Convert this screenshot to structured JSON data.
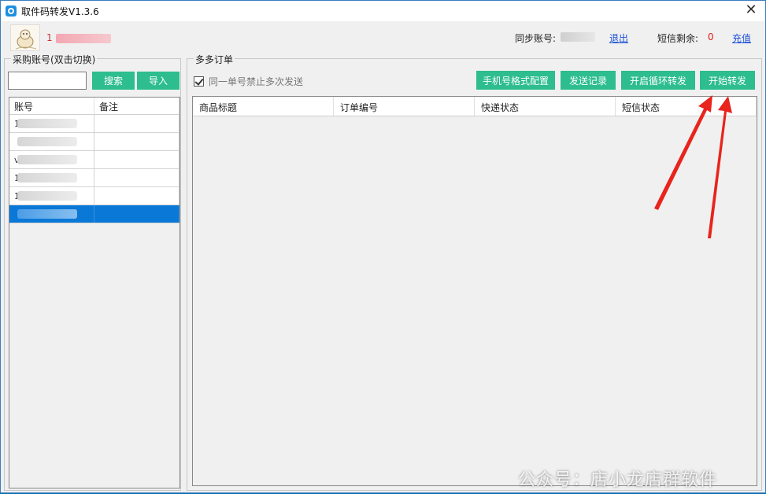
{
  "window": {
    "title": "取件码转发V1.3.6",
    "close_glyph": "✕"
  },
  "header": {
    "user_name_prefix": "1",
    "sync_account_label": "同步账号:",
    "logout_label": "退出",
    "sms_remaining_label": "短信剩余:",
    "sms_remaining_value": "0",
    "recharge_label": "充值"
  },
  "left_panel": {
    "title": "采购账号(双击切换)",
    "search_input_value": "",
    "search_label": "搜索",
    "import_label": "导入",
    "columns": [
      "账号",
      "备注"
    ],
    "rows": [
      {
        "prefix": "1",
        "note": ""
      },
      {
        "prefix": "",
        "note": ""
      },
      {
        "prefix": "v",
        "note": ""
      },
      {
        "prefix": "1",
        "note": ""
      },
      {
        "prefix": "1",
        "note": ""
      },
      {
        "prefix": "",
        "note": "",
        "selected": true
      }
    ]
  },
  "right_panel": {
    "title": "多多订单",
    "checkbox_label": "同一单号禁止多次发送",
    "checkbox_checked": true,
    "phone_format_label": "手机号格式配置",
    "send_log_label": "发送记录",
    "loop_forward_label": "开启循环转发",
    "start_forward_label": "开始转发",
    "columns": [
      "商品标题",
      "订单编号",
      "快递状态",
      "短信状态"
    ]
  },
  "watermark": "公众号：店小龙店群软件",
  "colors": {
    "button_green": "#2dbd8e",
    "selected_row": "#0a78d7",
    "link_blue": "#1a4fd6",
    "sms_red": "#e01c1c",
    "arrow_red": "#e8241c"
  }
}
